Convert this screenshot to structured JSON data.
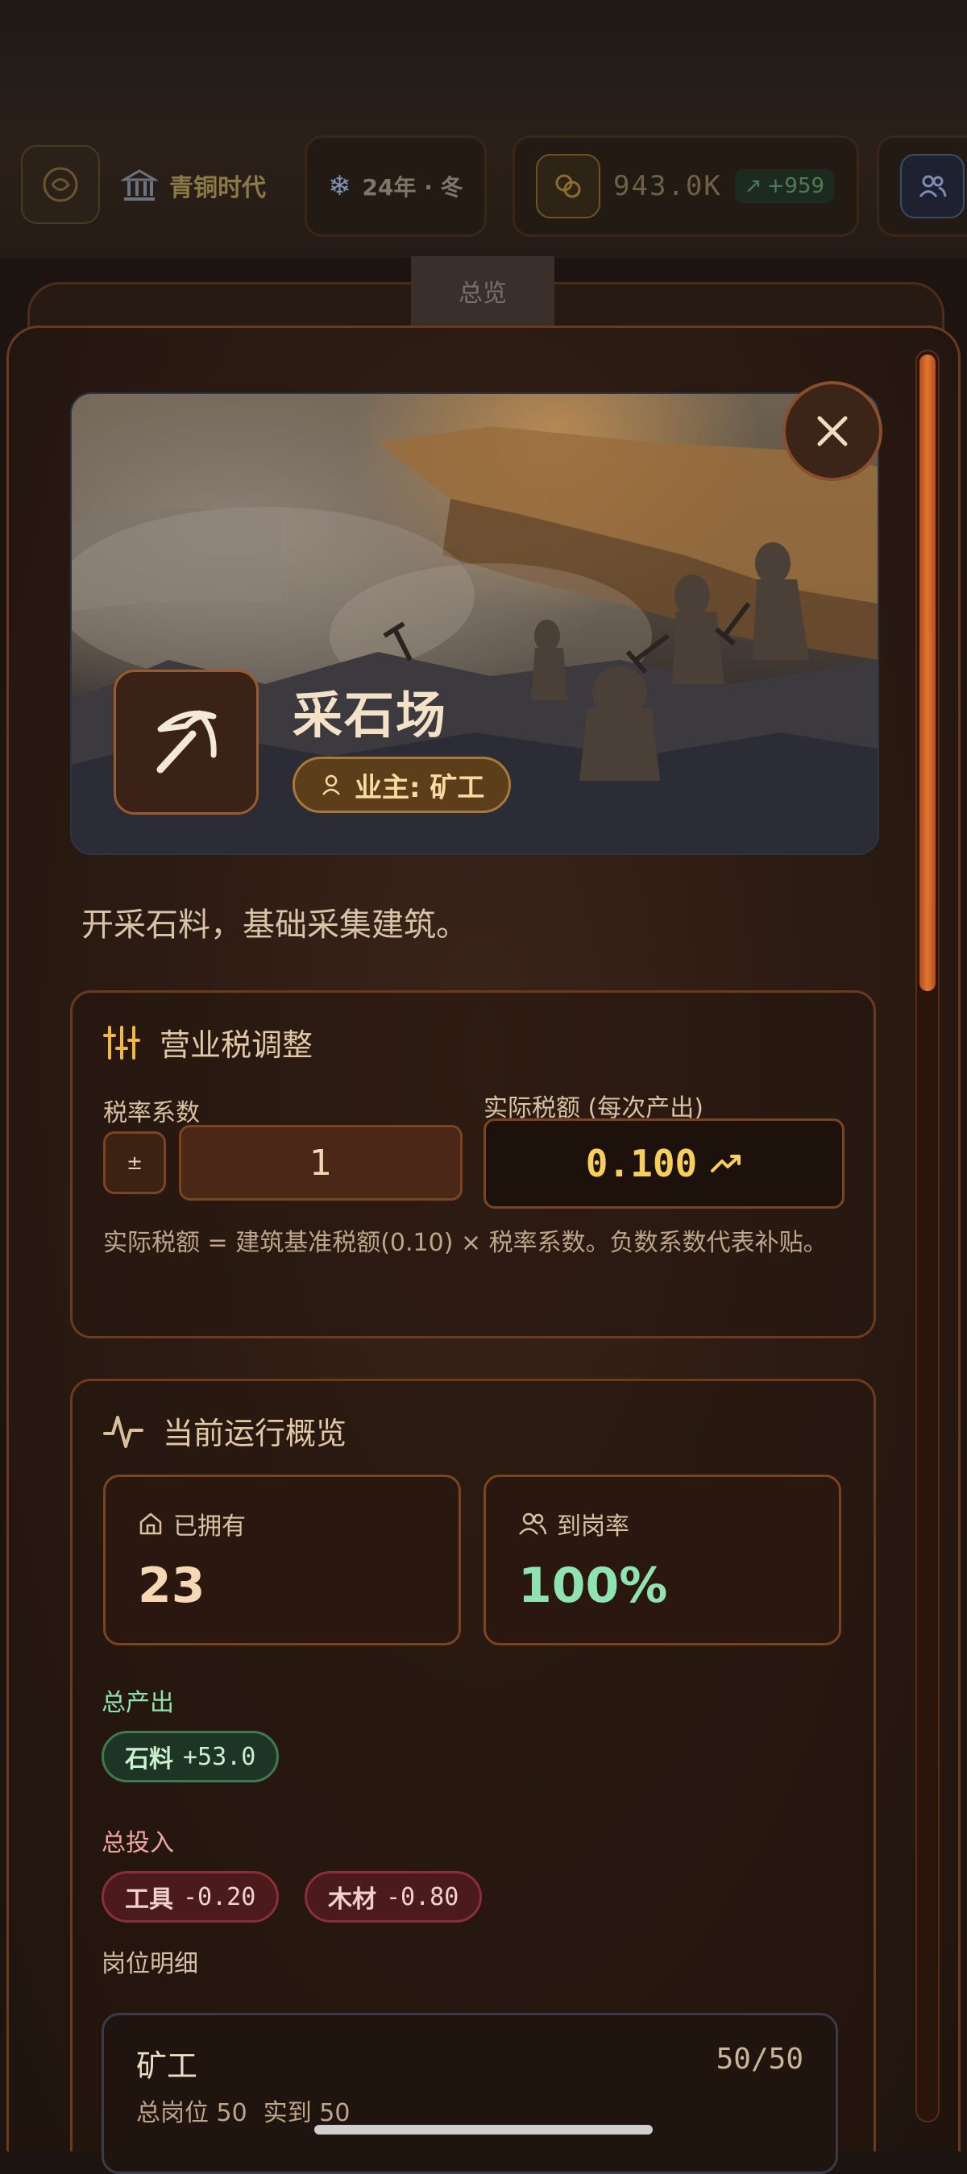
{
  "topbar": {
    "era": "青铜时代",
    "season": "24年 · 冬",
    "coins": "943.0K",
    "coins_delta": "+959"
  },
  "tabs": {
    "overview": "总览"
  },
  "building": {
    "name": "采石场",
    "owner": "业主: 矿工",
    "description": "开采石料，基础采集建筑。"
  },
  "tax_card": {
    "title": "营业税调整",
    "rate_label": "税率系数",
    "toggle_sign": "±",
    "rate_value": "1",
    "actual_label": "实际税额 (每次产出)",
    "actual_value": "0.100",
    "note": "实际税额 = 建筑基准税额(0.10) × 税率系数。负数系数代表补贴。"
  },
  "overview_card": {
    "title": "当前运行概览",
    "owned_label": "已拥有",
    "owned_value": "23",
    "staffing_label": "到岗率",
    "staffing_value": "100%",
    "output_label": "总产出",
    "outputs": [
      {
        "name": "石料",
        "value": "+53.0"
      }
    ],
    "input_label": "总投入",
    "inputs": [
      {
        "name": "工具",
        "value": "-0.20"
      },
      {
        "name": "木材",
        "value": "-0.80"
      }
    ],
    "jobs_label": "岗位明细",
    "jobs": [
      {
        "name": "矿工",
        "count": "50/50",
        "total": "总岗位 50",
        "present": "实到 50"
      }
    ]
  },
  "colors": {
    "accent": "#e0772f",
    "gold": "#f7cf5a",
    "positive": "#8fe3b0",
    "value_light": "#f6d9b4"
  }
}
